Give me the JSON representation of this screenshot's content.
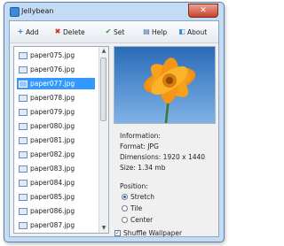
{
  "window": {
    "title": "Jellybean",
    "close_glyph": "✕"
  },
  "toolbar": {
    "add_label": "Add",
    "delete_label": "Delete",
    "set_label": "Set",
    "help_label": "Help",
    "about_label": "About"
  },
  "files": [
    {
      "name": "paper075.jpg",
      "selected": false
    },
    {
      "name": "paper076.jpg",
      "selected": false
    },
    {
      "name": "paper077.jpg",
      "selected": true
    },
    {
      "name": "paper078.jpg",
      "selected": false
    },
    {
      "name": "paper079.jpg",
      "selected": false
    },
    {
      "name": "paper080.jpg",
      "selected": false
    },
    {
      "name": "paper081.jpg",
      "selected": false
    },
    {
      "name": "paper082.jpg",
      "selected": false
    },
    {
      "name": "paper083.jpg",
      "selected": false
    },
    {
      "name": "paper084.jpg",
      "selected": false
    },
    {
      "name": "paper085.jpg",
      "selected": false
    },
    {
      "name": "paper086.jpg",
      "selected": false
    },
    {
      "name": "paper087.jpg",
      "selected": false
    }
  ],
  "info": {
    "heading": "Information:",
    "format": "Format: JPG",
    "dimensions": "Dimensions: 1920 x 1440",
    "size": "Size: 1.34 mb"
  },
  "position": {
    "heading": "Position:",
    "options": [
      {
        "label": "Stretch",
        "checked": true
      },
      {
        "label": "Tile",
        "checked": false
      },
      {
        "label": "Center",
        "checked": false
      }
    ]
  },
  "shuffle": {
    "label": "Shuffle Wallpaper",
    "checked": true,
    "check_glyph": "✓"
  },
  "colors": {
    "selection": "#3399ff",
    "frame": "#c3dcf3",
    "close": "#c8432b"
  }
}
